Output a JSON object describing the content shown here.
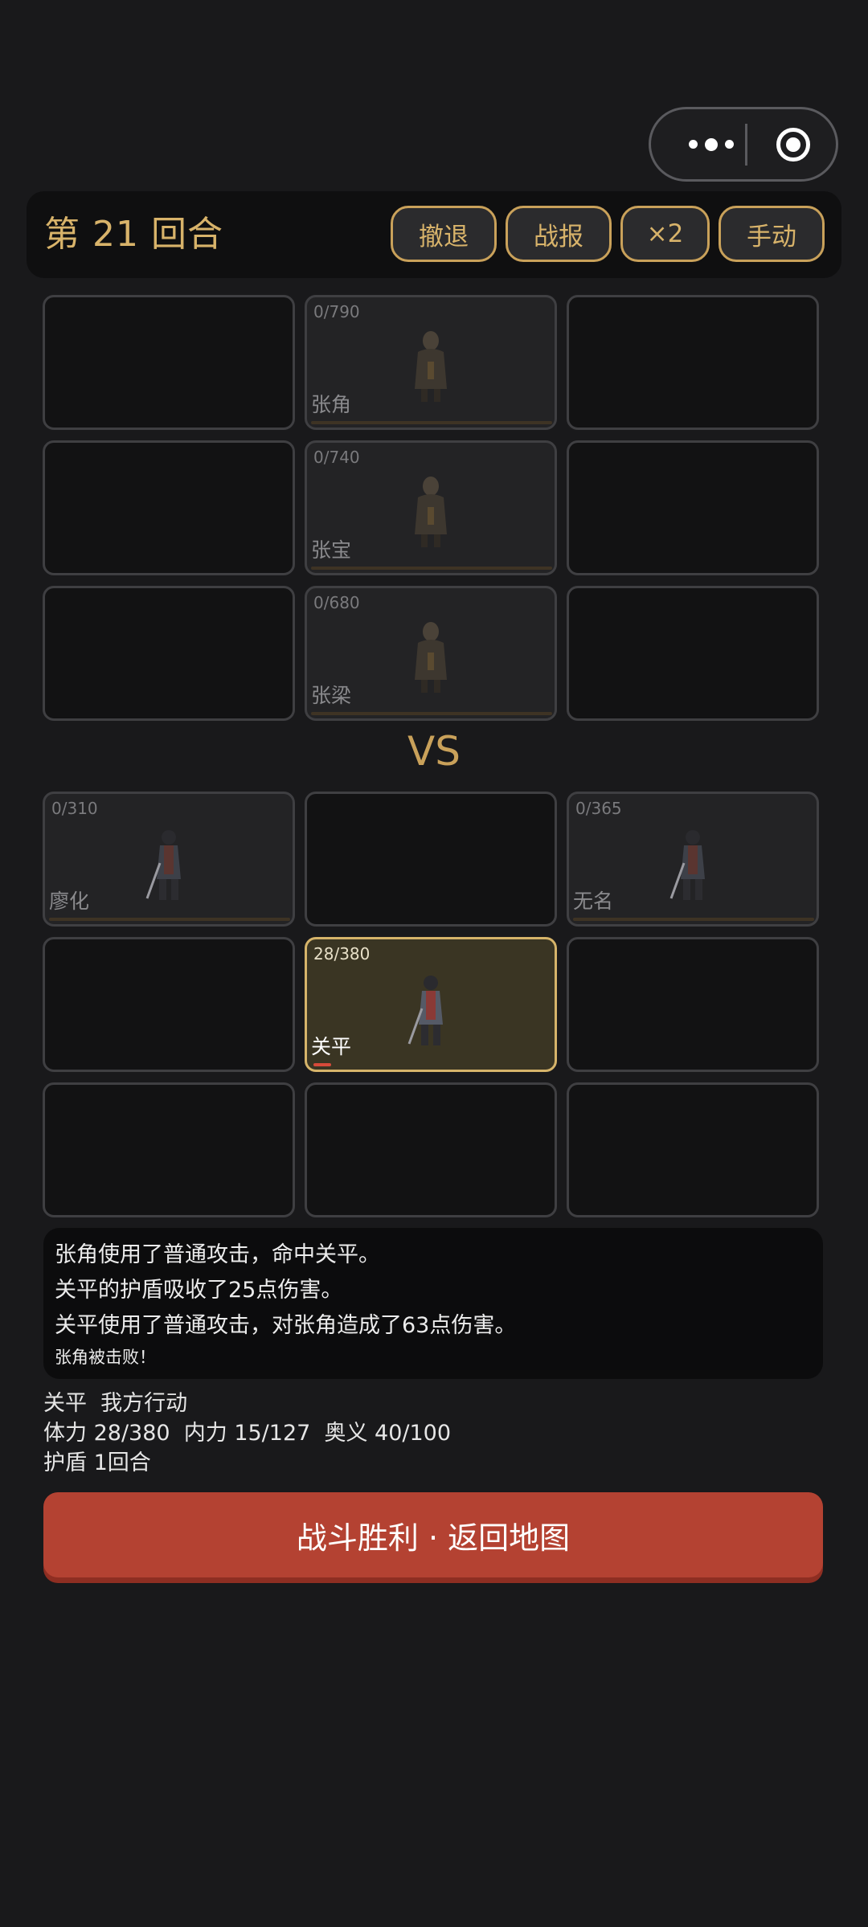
{
  "header": {
    "round_title": "第 21 回合",
    "buttons": [
      "撤退",
      "战报",
      "×2",
      "手动"
    ]
  },
  "enemy_grid": [
    [
      null,
      {
        "hp": "0/790",
        "name": "张角"
      },
      null
    ],
    [
      null,
      {
        "hp": "0/740",
        "name": "张宝"
      },
      null
    ],
    [
      null,
      {
        "hp": "0/680",
        "name": "张梁"
      },
      null
    ]
  ],
  "vs_label": "VS",
  "ally_grid": [
    [
      {
        "hp": "0/310",
        "name": "廖化"
      },
      null,
      {
        "hp": "0/365",
        "name": "无名"
      }
    ],
    [
      null,
      {
        "hp": "28/380",
        "name": "关平",
        "active": true,
        "hp_fraction": 0.074
      },
      null
    ],
    [
      null,
      null,
      null
    ]
  ],
  "log": [
    "张角使用了普通攻击，命中关平。",
    "关平的护盾吸收了25点伤害。",
    "关平使用了普通攻击，对张角造成了63点伤害。",
    "张角被击败！"
  ],
  "status": {
    "line1": "关平  我方行动",
    "line2": "体力 28/380  内力 15/127  奥义 40/100",
    "line3": "护盾 1回合"
  },
  "victory_button": "战斗胜利 · 返回地图",
  "colors": {
    "accent_gold": "#d8b36a",
    "victory_red": "#b44232",
    "background": "#19191b"
  }
}
